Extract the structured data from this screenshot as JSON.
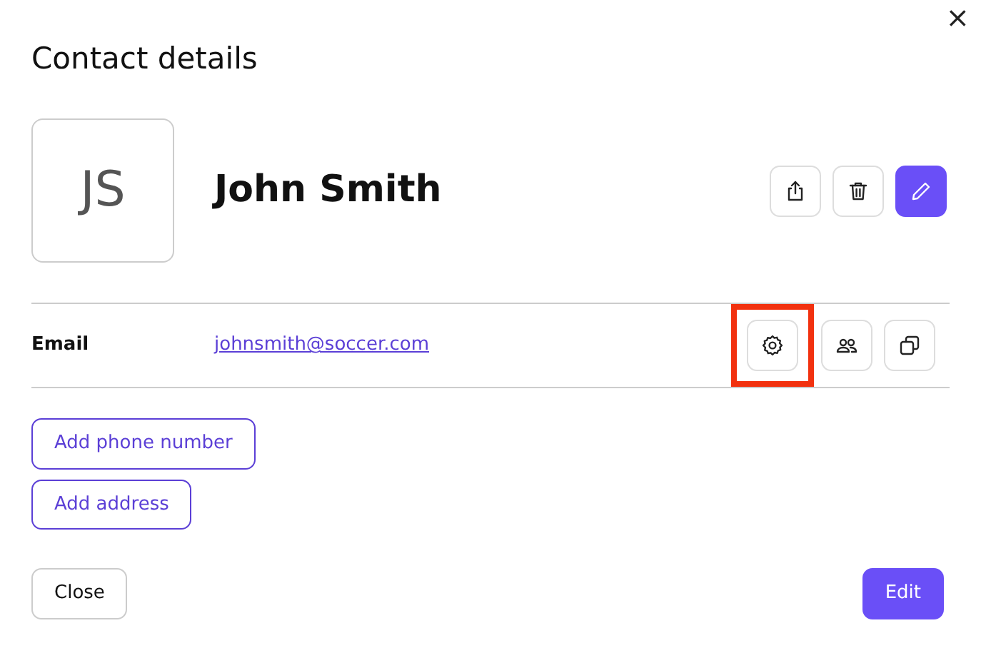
{
  "dialog": {
    "title": "Contact details",
    "close_glyph": "×"
  },
  "contact": {
    "initials": "JS",
    "name": "John Smith"
  },
  "header_actions": [
    {
      "kind": "share",
      "primary": false
    },
    {
      "kind": "delete",
      "primary": false
    },
    {
      "kind": "edit",
      "primary": true
    }
  ],
  "email": {
    "label": "Email",
    "value": "johnsmith@soccer.com"
  },
  "email_actions": [
    {
      "kind": "settings",
      "highlighted": true
    },
    {
      "kind": "people",
      "highlighted": false
    },
    {
      "kind": "copy",
      "highlighted": false
    }
  ],
  "add_buttons": [
    "Add phone number",
    "Add address"
  ],
  "footer": {
    "close": "Close",
    "edit": "Edit"
  }
}
